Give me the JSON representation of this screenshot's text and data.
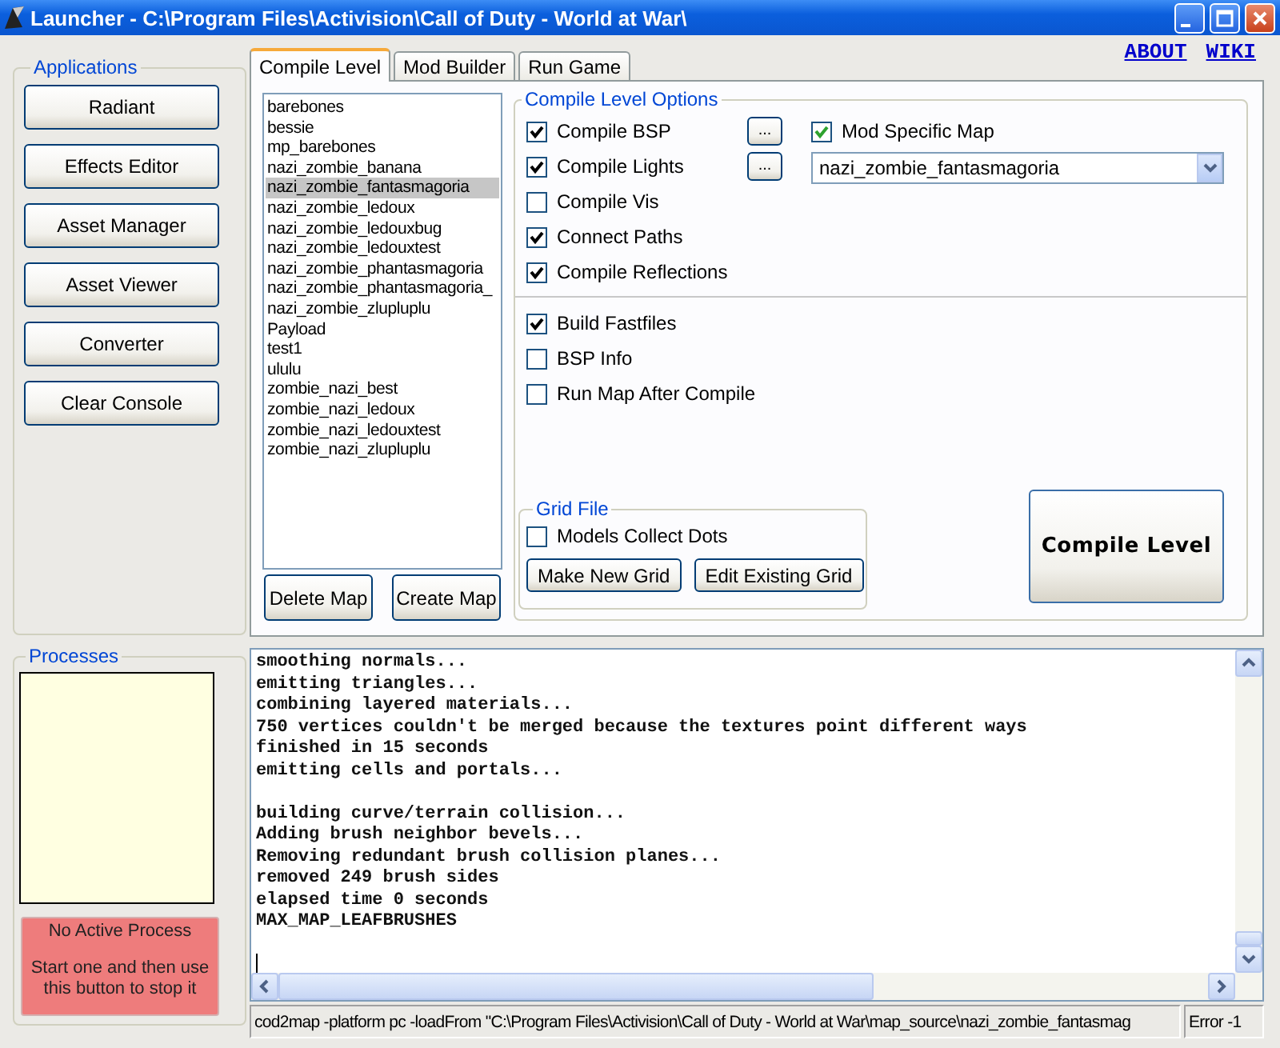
{
  "window": {
    "title": "Launcher - C:\\Program Files\\Activision\\Call of Duty - World at War\\"
  },
  "links": [
    "ABOUT",
    "WIKI"
  ],
  "applications": {
    "title": "Applications",
    "buttons": [
      "Radiant",
      "Effects Editor",
      "Asset Manager",
      "Asset Viewer",
      "Converter"
    ],
    "clear_button": "Clear Console"
  },
  "processes": {
    "title": "Processes",
    "stop_button": {
      "status": "No Active Process",
      "hint": "Start one and then use this button to stop it"
    }
  },
  "tabs": [
    {
      "label": "Compile Level",
      "selected": true
    },
    {
      "label": "Mod Builder",
      "selected": false
    },
    {
      "label": "Run Game",
      "selected": false
    }
  ],
  "maps": [
    {
      "name": "barebones",
      "selected": false
    },
    {
      "name": "bessie",
      "selected": false
    },
    {
      "name": "mp_barebones",
      "selected": false
    },
    {
      "name": "nazi_zombie_banana",
      "selected": false
    },
    {
      "name": "nazi_zombie_fantasmagoria",
      "selected": true
    },
    {
      "name": "nazi_zombie_ledoux",
      "selected": false
    },
    {
      "name": "nazi_zombie_ledouxbug",
      "selected": false
    },
    {
      "name": "nazi_zombie_ledouxtest",
      "selected": false
    },
    {
      "name": "nazi_zombie_phantasmagoria",
      "selected": false
    },
    {
      "name": "nazi_zombie_phantasmagoria_",
      "selected": false
    },
    {
      "name": "nazi_zombie_zlupluplu",
      "selected": false
    },
    {
      "name": "Payload",
      "selected": false
    },
    {
      "name": "test1",
      "selected": false
    },
    {
      "name": "ululu",
      "selected": false
    },
    {
      "name": "zombie_nazi_best",
      "selected": false
    },
    {
      "name": "zombie_nazi_ledoux",
      "selected": false
    },
    {
      "name": "zombie_nazi_ledouxtest",
      "selected": false
    },
    {
      "name": "zombie_nazi_zlupluplu",
      "selected": false
    }
  ],
  "map_buttons": [
    "Delete Map",
    "Create Map"
  ],
  "options": {
    "title": "Compile Level Options",
    "compile_items": [
      {
        "label": "Compile BSP",
        "checked": true,
        "settings_button": "..."
      },
      {
        "label": "Compile Lights",
        "checked": true,
        "settings_button": "..."
      },
      {
        "label": "Compile Vis",
        "checked": false
      },
      {
        "label": "Connect Paths",
        "checked": true
      },
      {
        "label": "Compile Reflections",
        "checked": true
      }
    ],
    "mod_specific_map": {
      "label": "Mod Specific Map",
      "checked": true,
      "value": "nazi_zombie_fantasmagoria"
    },
    "build_items": [
      {
        "label": "Build Fastfiles",
        "checked": true
      },
      {
        "label": "BSP Info",
        "checked": false
      },
      {
        "label": "Run Map After Compile",
        "checked": false
      }
    ],
    "grid_file": {
      "title": "Grid File",
      "checkbox": {
        "label": "Models Collect Dots",
        "checked": false
      },
      "buttons": [
        "Make New Grid",
        "Edit Existing Grid"
      ]
    },
    "compile_button": "Compile Level"
  },
  "console": {
    "paragraphs": [
      [
        "smoothing normals...",
        "emitting triangles...",
        "combining layered materials...",
        "750 vertices couldn't be merged because the textures point different ways",
        "finished in 15 seconds",
        "emitting cells and portals..."
      ],
      [
        "building curve/terrain collision...",
        "Adding brush neighbor bevels...",
        "Removing redundant brush collision planes...",
        "removed 249 brush sides",
        "elapsed time 0 seconds",
        "MAX_MAP_LEAFBRUSHES"
      ]
    ]
  },
  "status_bar": {
    "command": "cod2map -platform pc -loadFrom \"C:\\Program Files\\Activision\\Call of Duty - World at War\\map_source\\nazi_zombie_fantasmag",
    "error": "Error -1"
  }
}
